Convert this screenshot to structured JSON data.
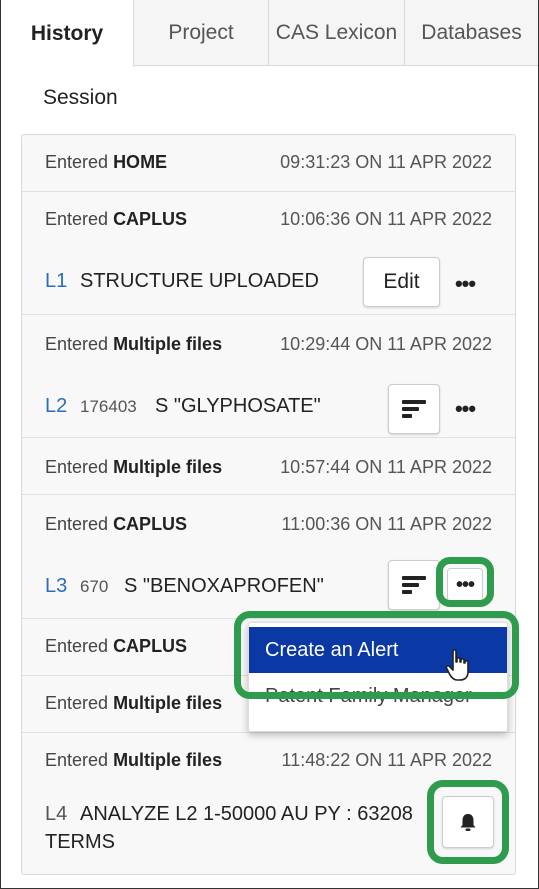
{
  "tabs": [
    {
      "label": "History",
      "active": true
    },
    {
      "label": "Project",
      "active": false
    },
    {
      "label": "CAS Lexicon",
      "active": false
    },
    {
      "label": "Databases",
      "active": false
    }
  ],
  "section_title": "Session",
  "entries": [
    {
      "prefix": "Entered",
      "db": "HOME",
      "time": "09:31:23 ON 11 APR 2022"
    },
    {
      "prefix": "Entered",
      "db": "CAPLUS",
      "time": "10:06:36 ON 11 APR 2022"
    },
    {
      "prefix": "Entered",
      "db": "Multiple files",
      "time": "10:29:44 ON 11 APR 2022"
    },
    {
      "prefix": "Entered",
      "db": "Multiple files",
      "time": "10:57:44 ON 11 APR 2022"
    },
    {
      "prefix": "Entered",
      "db": "CAPLUS",
      "time": "11:00:36 ON 11 APR 2022"
    },
    {
      "prefix": "Entered",
      "db": "CAPLUS",
      "time": ""
    },
    {
      "prefix": "Entered",
      "db": "Multiple files",
      "time": ""
    },
    {
      "prefix": "Entered",
      "db": "Multiple files",
      "time": "11:48:22 ON 11 APR 2022"
    }
  ],
  "queries": [
    {
      "id": "L1",
      "count": "",
      "text": "STRUCTURE UPLOADED",
      "button": "Edit"
    },
    {
      "id": "L2",
      "count": "176403",
      "text": "S \"GLYPHOSATE\""
    },
    {
      "id": "L3",
      "count": "670",
      "text": "S \"BENOXAPROFEN\""
    },
    {
      "id": "L4",
      "count": "",
      "text_line1": "ANALYZE L2 1-50000 AU PY : 63208",
      "text_line2": "TERMS"
    }
  ],
  "menu": {
    "items": [
      {
        "label": "Create an Alert",
        "selected": true
      },
      {
        "label": "Patent Family Manager",
        "selected": false
      }
    ]
  },
  "icons": {
    "more": "more-horizontal-icon",
    "sort": "sort-lines-icon",
    "bell": "bell-icon",
    "cursor": "hand-pointer-icon"
  },
  "colors": {
    "highlight": "#2e9b4d",
    "menu_selected": "#0a38a5",
    "link": "#2a6ebb"
  },
  "more_glyph": "•••"
}
